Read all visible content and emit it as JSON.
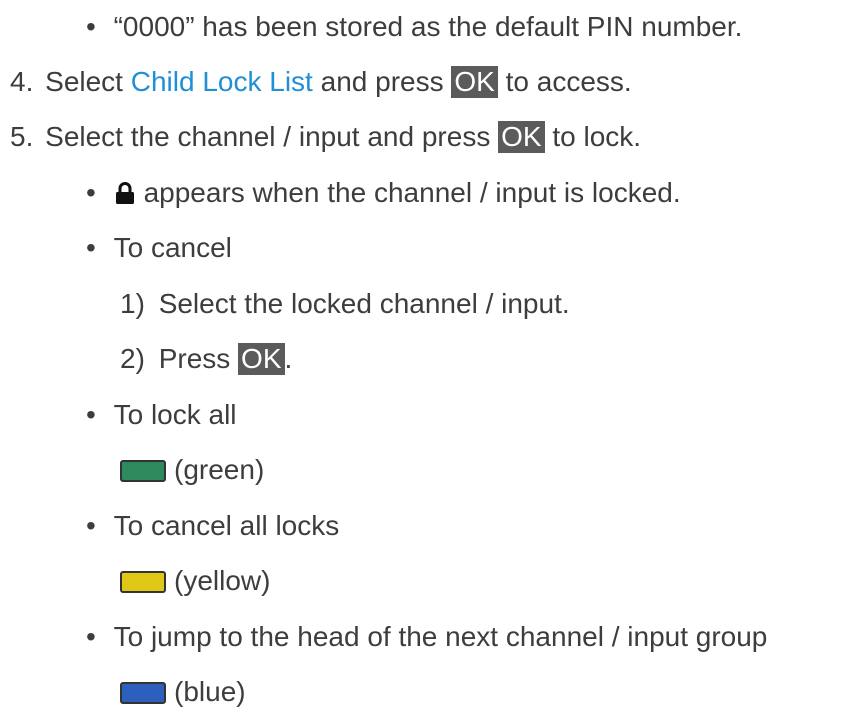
{
  "bullet_char": "•",
  "note_default_pin": "“0000” has been stored as the default PIN number.",
  "step4": {
    "number": "4.",
    "text_before": "Select ",
    "link": "Child Lock List",
    "text_mid": " and press ",
    "key": "OK",
    "text_after": " to access."
  },
  "step5": {
    "number": "5.",
    "text_before": "Select the channel / input and press ",
    "key": "OK",
    "text_after": " to lock."
  },
  "lock_note": {
    "icon": "lock-icon",
    "text": "appears when the channel / input is locked."
  },
  "cancel": {
    "heading": "To cancel",
    "sub1_number": "1)",
    "sub1_text": "Select the locked channel / input.",
    "sub2_number": "2)",
    "sub2_text": "Press ",
    "sub2_key": "OK",
    "sub2_after": "."
  },
  "lock_all": {
    "heading": "To lock all",
    "button_color": "#2e8a5c",
    "button_label": "(green)"
  },
  "cancel_all": {
    "heading": "To cancel all locks",
    "button_color": "#e0c615",
    "button_label": "(yellow)"
  },
  "jump": {
    "heading": "To jump to the head of the next channel / input group",
    "button_color": "#2d5fbd",
    "button_label": "(blue)"
  }
}
